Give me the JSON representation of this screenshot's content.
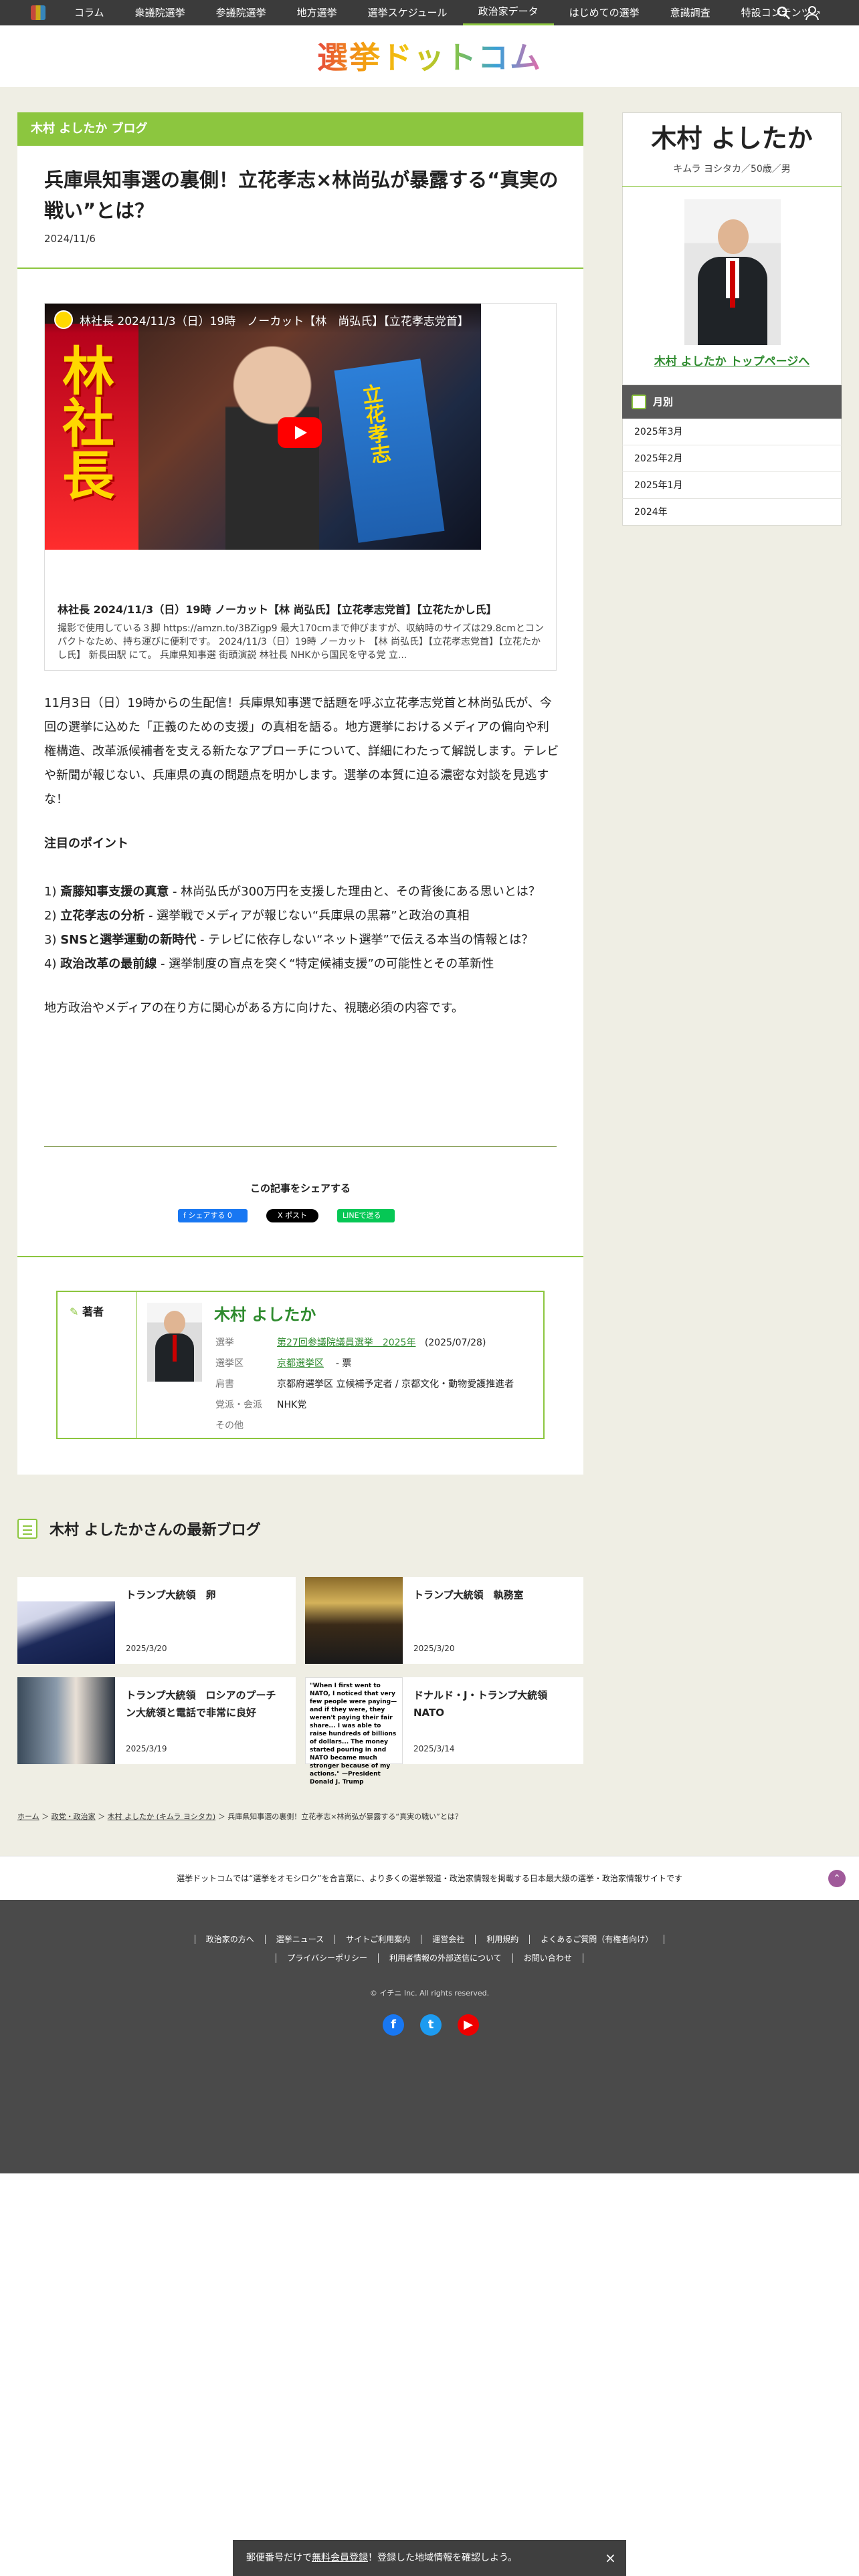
{
  "nav": {
    "items": [
      {
        "label": "コラム"
      },
      {
        "label": "衆議院選挙"
      },
      {
        "label": "参議院選挙"
      },
      {
        "label": "地方選挙"
      },
      {
        "label": "選挙スケジュール"
      },
      {
        "label": "政治家データ",
        "active": true
      },
      {
        "label": "はじめての選挙"
      },
      {
        "label": "意識調査"
      },
      {
        "label": "特設コンテンツ",
        "external": true
      }
    ]
  },
  "site": {
    "brand": "選挙ドットコム"
  },
  "post": {
    "blog_label": "木村 よしたか ブログ",
    "title": "兵庫県知事選の裏側！立花孝志×林尚弘が暴露する“真実の戦い”とは？",
    "date": "2024/11/6",
    "video": {
      "overlay_title": "林社長 2024/11/3（日）19時　ノーカット【林　尚弘氏】【立花孝志党首】",
      "kanji": "林社長",
      "banner": "立花孝志",
      "caption_title": "林社長 2024/11/3（日）19時 ノーカット【林 尚弘氏】【立花孝志党首】【立花たかし氏】",
      "caption_desc": "撮影で使用している３脚 https://amzn.to/3BZigp9 最大170cmまで伸びますが、収納時のサイズは29.8cmとコンパクトなため、持ち運びに便利です。 2024/11/3（日）19時 ノーカット 【林 尚弘氏】【立花孝志党首】【立花たかし氏】 新長田駅 にて。 兵庫県知事選 街頭演説 林社長 NHKから国民を守る党 立..."
    },
    "intro": "11月3日（日）19時からの生配信！兵庫県知事選で話題を呼ぶ立花孝志党首と林尚弘氏が、今回の選挙に込めた「正義のための支援」の真相を語る。地方選挙におけるメディアの偏向や利権構造、改革派候補者を支える新たなアプローチについて、詳細にわたって解説します。テレビや新聞が報じない、兵庫県の真の問題点を明かします。選挙の本質に迫る濃密な対談を見逃すな！",
    "points_heading": "注目のポイント",
    "points": [
      {
        "num": "1)",
        "head": "斎藤知事支援の真意",
        "text": " - 林尚弘氏が300万円を支援した理由と、その背後にある思いとは？"
      },
      {
        "num": "2)",
        "head": "立花孝志の分析",
        "text": " - 選挙戦でメディアが報じない“兵庫県の黒幕”と政治の真相"
      },
      {
        "num": "3)",
        "head": "SNSと選挙運動の新時代",
        "text": " - テレビに依存しない“ネット選挙”で伝える本当の情報とは？"
      },
      {
        "num": "4)",
        "head": "政治改革の最前線",
        "text": " - 選挙制度の盲点を突く“特定候補支援”の可能性とその革新性"
      }
    ],
    "closing": "地方政治やメディアの在り方に関心がある方に向けた、視聴必須の内容です。",
    "share": {
      "title": "この記事をシェアする",
      "fb": "f シェアする 0",
      "x": "X ポスト",
      "line": "LINEで送る"
    }
  },
  "author": {
    "label": "著者",
    "name": "木村 よしたか",
    "rows": [
      {
        "key": "選挙",
        "value": "第27回参議院議員選挙　2025年",
        "link": true,
        "extra": "(2025/07/28)"
      },
      {
        "key": "選挙区",
        "value": "京都選挙区",
        "link": true,
        "extra": "- 票"
      },
      {
        "key": "肩書",
        "value": "京都府選挙区 立候補予定者 / 京都文化・動物愛護推進者",
        "link": false,
        "extra": ""
      },
      {
        "key": "党派・会派",
        "value": "NHK党",
        "link": false,
        "extra": ""
      },
      {
        "key": "その他",
        "value": "",
        "link": false,
        "extra": ""
      }
    ]
  },
  "sidebar": {
    "name": "木村 よしたか",
    "sub": "キムラ ヨシタカ／50歳／男",
    "top_link": "木村 よしたか トップページへ",
    "month_head": "月別",
    "months": [
      "2025年3月",
      "2025年2月",
      "2025年1月",
      "2024年"
    ]
  },
  "latest": {
    "heading": "木村 よしたかさんの最新ブログ",
    "cards": [
      {
        "title": "トランプ大統領　卵",
        "date": "2025/3/20"
      },
      {
        "title": "トランプ大統領　執務室",
        "date": "2025/3/20"
      },
      {
        "title": "トランプ大統領　ロシアのプーチン大統領と電話で非常に良好",
        "date": "2025/3/19"
      },
      {
        "title": "ドナルド・J・トランプ大統領 NATO",
        "date": "2025/3/14",
        "thumb_text": "\"When I first went to NATO, I noticed that very few people were paying—and if they were, they weren't paying their fair share... I was able to raise hundreds of billions of dollars... The money started pouring in and NATO became much stronger because of my actions.\" —President Donald J. Trump"
      }
    ]
  },
  "breadcrumb": [
    "ホーム",
    "政党・政治家",
    "木村 よしたか (キムラ ヨシタカ)",
    "兵庫県知事選の裏側！立花孝志×林尚弘が暴露する“真実の戦い”とは？"
  ],
  "footer": {
    "message": "選挙ドットコムでは“選挙をオモシロク”を合言葉に、より多くの選挙報道・政治家情報を掲載する日本最大級の選挙・政治家情報サイトです",
    "links_row1": [
      "政治家の方へ",
      "選挙ニュース",
      "サイトご利用案内",
      "運営会社",
      "利用規約",
      "よくあるご質問（有権者向け）"
    ],
    "links_row2": [
      "プライバシーポリシー",
      "利用者情報の外部送信について",
      "お問い合わせ"
    ],
    "copyright": "© イチニ Inc. All rights reserved."
  },
  "banner": {
    "text_pre": "郵便番号だけで",
    "text_link": "無料会員登録",
    "text_post": "！登録した地域情報を確認しよう。",
    "close": "×"
  },
  "colors": {
    "accent": "#8cc63f",
    "nav_bg": "#3b3b3b",
    "footer_bg": "#4a4a4a",
    "link": "#2e8b2e"
  }
}
